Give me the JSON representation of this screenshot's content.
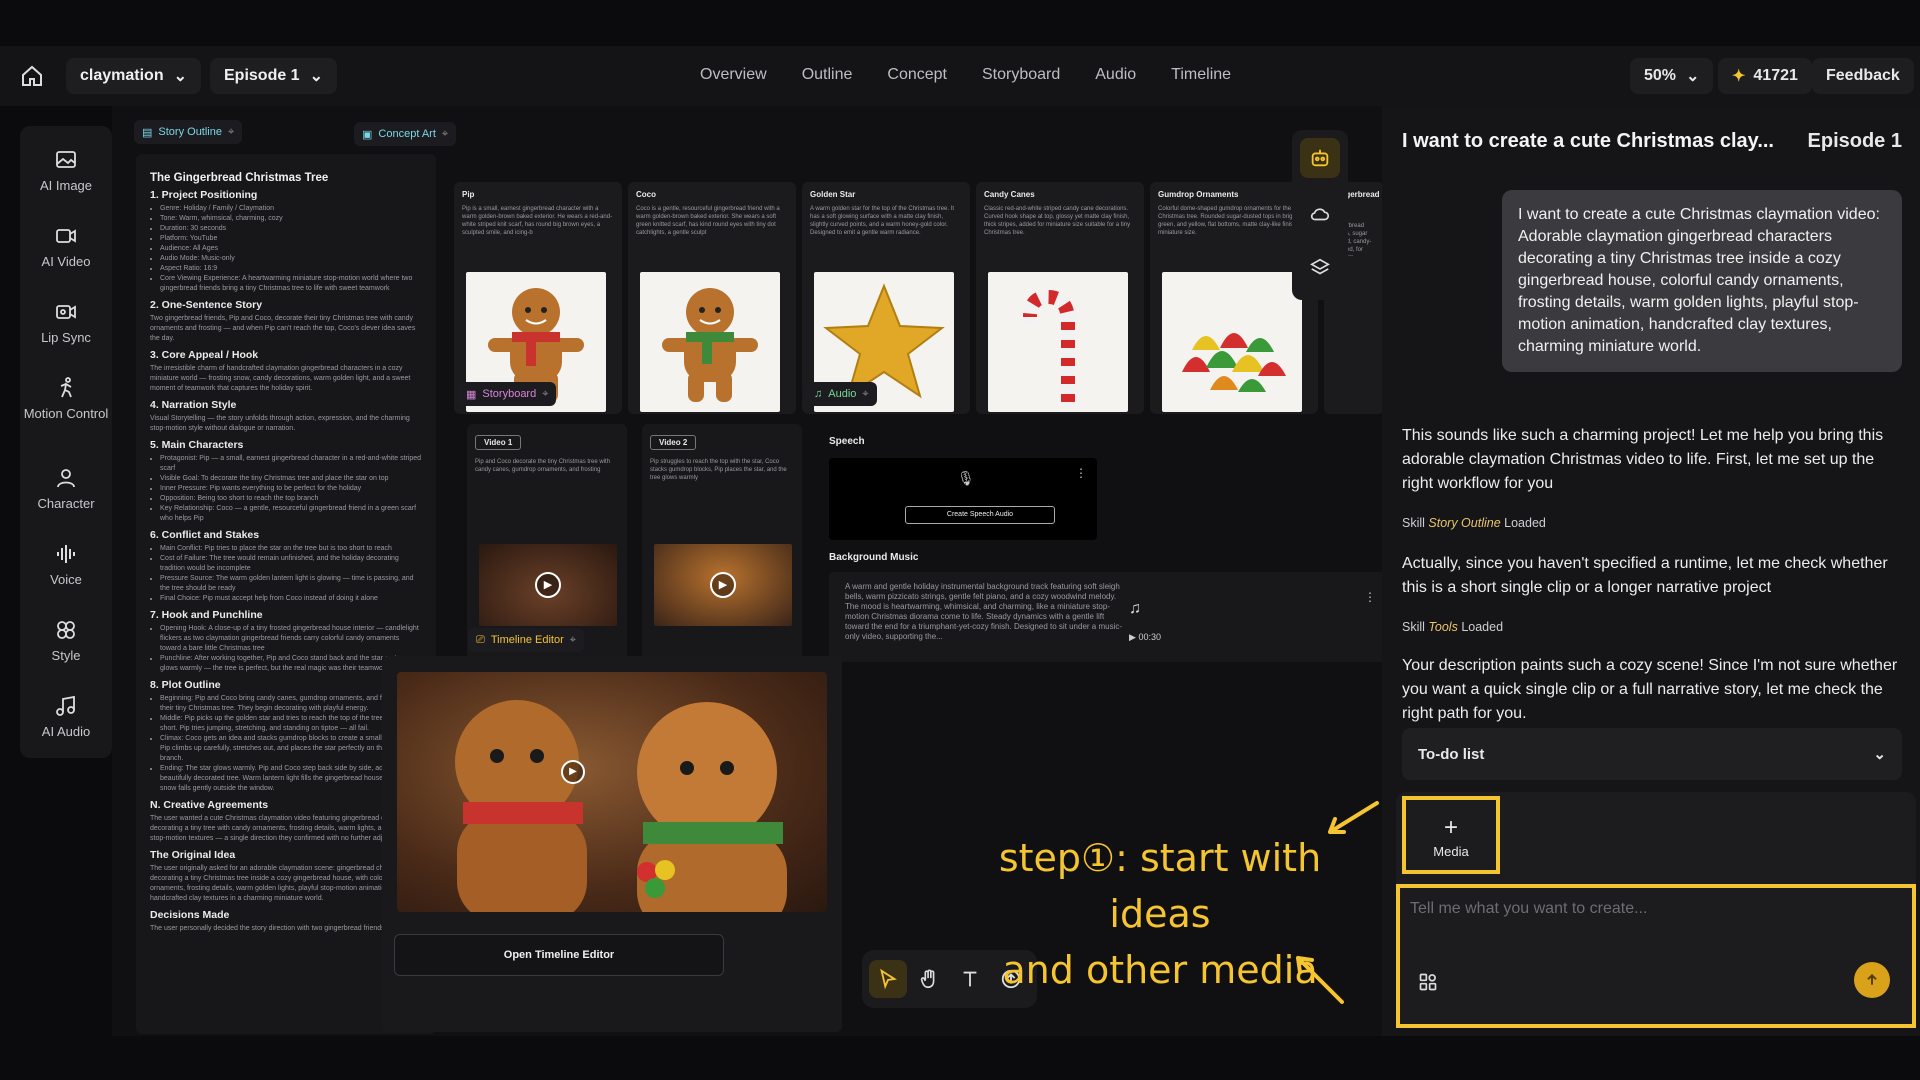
{
  "header": {
    "project": "claymation",
    "episode": "Episode 1",
    "nav": [
      "Overview",
      "Outline",
      "Concept",
      "Storyboard",
      "Audio",
      "Timeline"
    ],
    "zoom": "50%",
    "credits": "41721",
    "feedback": "Feedback"
  },
  "tools": [
    {
      "label": "AI Image",
      "icon": "ai-image-icon"
    },
    {
      "label": "AI Video",
      "icon": "ai-video-icon"
    },
    {
      "label": "Lip Sync",
      "icon": "lip-sync-icon"
    },
    {
      "label": "Motion Control",
      "icon": "motion-control-icon"
    },
    {
      "label": "Character",
      "icon": "character-icon"
    },
    {
      "label": "Voice",
      "icon": "voice-icon"
    },
    {
      "label": "Style",
      "icon": "style-icon"
    },
    {
      "label": "AI Audio",
      "icon": "ai-audio-icon"
    }
  ],
  "outline": {
    "tag": "Story Outline",
    "title": "The Gingerbread Christmas Tree",
    "h1": "1. Project Positioning",
    "items1": [
      "Genre: Holiday / Family / Claymation",
      "Tone: Warm, whimsical, charming, cozy",
      "Duration: 30 seconds",
      "Platform: YouTube",
      "Audience: All Ages",
      "Audio Mode: Music-only",
      "Aspect Ratio: 16:9",
      "Core Viewing Experience: A heartwarming miniature stop-motion world where two gingerbread friends bring a tiny Christmas tree to life with sweet teamwork"
    ],
    "h2": "2. One-Sentence Story",
    "p2": "Two gingerbread friends, Pip and Coco, decorate their tiny Christmas tree with candy ornaments and frosting — and when Pip can't reach the top, Coco's clever idea saves the day.",
    "h3": "3. Core Appeal / Hook",
    "p3": "The irresistible charm of handcrafted claymation gingerbread characters in a cozy miniature world — frosting snow, candy decorations, warm golden light, and a sweet moment of teamwork that captures the holiday spirit.",
    "h4": "4. Narration Style",
    "p4": "Visual Storytelling — the story unfolds through action, expression, and the charming stop-motion style without dialogue or narration.",
    "h5": "5. Main Characters",
    "items5": [
      "Protagonist: Pip — a small, earnest gingerbread character in a red-and-white striped scarf",
      "Visible Goal: To decorate the tiny Christmas tree and place the star on top",
      "Inner Pressure: Pip wants everything to be perfect for the holiday",
      "Opposition: Being too short to reach the top branch",
      "Key Relationship: Coco — a gentle, resourceful gingerbread friend in a green scarf who helps Pip"
    ],
    "h6": "6. Conflict and Stakes",
    "items6": [
      "Main Conflict: Pip tries to place the star on the tree but is too short to reach",
      "Cost of Failure: The tree would remain unfinished, and the holiday decorating tradition would be incomplete",
      "Pressure Source: The warm golden lantern light is glowing — time is passing, and the tree should be ready",
      "Final Choice: Pip must accept help from Coco instead of doing it alone"
    ],
    "h7": "7. Hook and Punchline",
    "items7": [
      "Opening Hook: A close-up of a tiny frosted gingerbread house interior — candlelight flickers as two claymation gingerbread friends carry colorful candy ornaments toward a bare little Christmas tree",
      "Punchline: After working together, Pip and Coco stand back and the star on top glows warmly — the tree is perfect, but the real magic was their teamwork"
    ],
    "h8": "8. Plot Outline",
    "items8": [
      "Beginning: Pip and Coco bring candy canes, gumdrop ornaments, and frosting to their tiny Christmas tree. They begin decorating with playful energy.",
      "Middle: Pip picks up the golden star and tries to reach the top of the tree, but is too short. Pip tries jumping, stretching, and standing on tiptoe — all fail.",
      "Climax: Coco gets an idea and stacks gumdrop blocks to create a small platform. Pip climbs up carefully, stretches out, and places the star perfectly on the top branch.",
      "Ending: The star glows warmly. Pip and Coco step back side by side, admiring their beautifully decorated tree. Warm lantern light fills the gingerbread house as frosting snow falls gently outside the window."
    ],
    "hN": "N. Creative Agreements",
    "pN": "The user wanted a cute Christmas claymation video featuring gingerbread characters decorating a tiny tree with candy ornaments, frosting details, warm lights, and charming stop-motion textures — a single direction they confirmed with no further adjustments.",
    "hO": "The Original Idea",
    "pO": "The user originally asked for an adorable claymation scene: gingerbread characters decorating a tiny Christmas tree inside a cozy gingerbread house, with colorful candy ornaments, frosting details, warm golden lights, playful stop-motion animation, and handcrafted clay textures in a charming miniature world.",
    "hD": "Decisions Made",
    "pD": "The user personally decided the story direction with two gingerbread friends"
  },
  "concept": {
    "tag": "Concept Art",
    "cards": [
      {
        "title": "Pip",
        "desc": "Pip is a small, earnest gingerbread character with a warm golden-brown baked exterior. He wears a red-and-white striped knit scarf, has round big brown eyes, a sculpted smile, and icing-b"
      },
      {
        "title": "Coco",
        "desc": "Coco is a gentle, resourceful gingerbread friend with a warm golden-brown baked exterior. She wears a soft green knitted scarf, has kind round eyes with tiny dot catchlights, a gentle sculpt"
      },
      {
        "title": "Golden Star",
        "desc": "A warm golden star for the top of the Christmas tree. It has a soft glowing surface with a matte clay finish, slightly curved points, and a warm honey-gold color. Designed to emit a gentle warm radiance."
      },
      {
        "title": "Candy Canes",
        "desc": "Classic red-and-white striped candy cane decorations. Curved hook shape at top, glossy yet matte clay finish, thick stripes, added for miniature size suitable for a tiny Christmas tree."
      },
      {
        "title": "Gumdrop Ornaments",
        "desc": "Colorful dome-shaped gumdrop ornaments for the Christmas tree. Rounded sugar-dusted tops in bright red, green, and yellow, flat bottoms, matte clay-like finish, miniature size."
      },
      {
        "title": "Gingerbread Blo",
        "desc": "Small gingerbread blocks, sugar coated, candy-stacked, for platform"
      }
    ],
    "storyboard_tag": "Storyboard",
    "audio_tag": "Audio"
  },
  "videos": [
    {
      "title": "Video 1",
      "desc": "Pip and Coco decorate the tiny Christmas tree with candy canes, gumdrop ornaments, and frosting"
    },
    {
      "title": "Video 2",
      "desc": "Pip struggles to reach the top with the star, Coco stacks gumdrop blocks, Pip places the star, and the tree glows warmly"
    }
  ],
  "timeline_tag": "Timeline Editor",
  "speech": {
    "label": "Speech",
    "button": "Create Speech Audio"
  },
  "bgm": {
    "label": "Background Music",
    "desc": "A warm and gentle holiday instrumental background track featuring soft sleigh bells, warm pizzicato strings, gentle felt piano, and a cozy woodwind melody. The mood is heartwarming, whimsical, and charming, like a miniature stop-motion Christmas diorama come to life. Steady dynamics with a gentle lift toward the end for a triumphant-yet-cozy finish. Designed to sit under a music-only video, supporting the...",
    "time": "00:30"
  },
  "open_timeline": "Open Timeline Editor",
  "annotation": {
    "line1": "step①: start with ideas",
    "line2": "and other media"
  },
  "chat": {
    "title": "I want to create a cute Christmas clay...",
    "episode": "Episode 1",
    "user_msg": "I want to create a cute Christmas claymation video: Adorable claymation gingerbread characters decorating a tiny Christmas tree inside a cozy gingerbread house, colorful candy ornaments, frosting details, warm golden lights, playful stop-motion animation, handcrafted clay textures, charming miniature world.",
    "msg1": "This sounds like such a charming project! Let me help you bring this adorable claymation Christmas video to life. First, let me set up the right workflow for you",
    "skill1_pre": "Skill",
    "skill1_name": "Story Outline",
    "skill1_post": "Loaded",
    "msg2": "Actually, since you haven't specified a runtime, let me check whether this is a short single clip or a longer narrative project",
    "skill2_pre": "Skill",
    "skill2_name": "Tools",
    "skill2_post": "Loaded",
    "msg3": "Your description paints such a cozy scene! Since I'm not sure whether you want a quick single clip or a full narrative story, let me check the right path for you.",
    "todo": "To-do list",
    "media": "Media",
    "placeholder": "Tell me what you want to create..."
  },
  "colors": {
    "accent": "#f5c431",
    "send": "#d9a21a"
  }
}
